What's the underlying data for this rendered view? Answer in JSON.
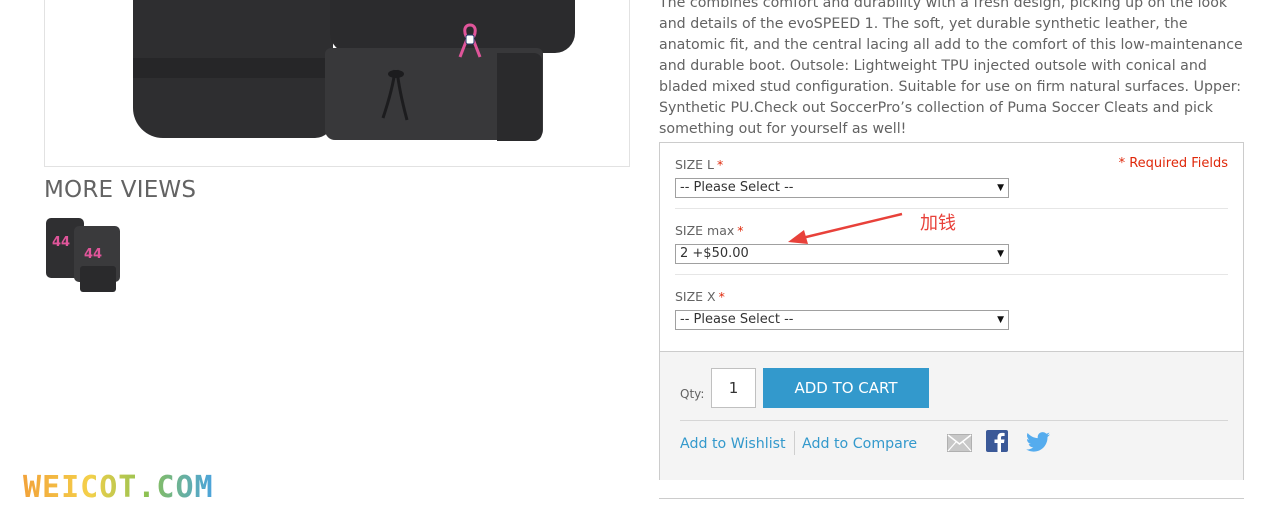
{
  "gallery": {
    "more_views_label": "MORE VIEWS"
  },
  "description": {
    "lines": [
      "The combines comfort and durability with a fresh design, picking up on the look",
      "and details of the evoSPEED 1. The soft, yet durable synthetic leather, the",
      "anatomic fit, and the central lacing all add to the comfort of this low-maintenance",
      "and durable boot. Outsole: Lightweight TPU injected outsole with conical and",
      "bladed mixed stud configuration. Suitable for use on firm natural surfaces. Upper:",
      "Synthetic PU.Check out SoccerPro’s collection of Puma Soccer Cleats and pick",
      "something out for yourself as well!"
    ]
  },
  "options": {
    "required_note": "* Required Fields",
    "required_marker": "*",
    "size_l": {
      "label": "SIZE L",
      "value": "-- Please Select --"
    },
    "size_max": {
      "label": "SIZE max",
      "value": "2 +$50.00"
    },
    "size_x": {
      "label": "SIZE X",
      "value": "-- Please Select --"
    }
  },
  "cart": {
    "qty_label": "Qty:",
    "qty_value": "1",
    "add_to_cart_label": "ADD TO CART",
    "wishlist_label": "Add to Wishlist",
    "compare_label": "Add to Compare"
  },
  "annotation": {
    "text": "加钱"
  },
  "watermark": {
    "text": "WEICOT.COM"
  },
  "icons": {
    "email": "email-icon",
    "facebook": "facebook-icon",
    "twitter": "twitter-icon",
    "dropdown": "chevron-down-icon"
  },
  "colors": {
    "accent": "#3399cc",
    "required": "#df280a",
    "annotation": "#e8413a",
    "facebook": "#3b5998",
    "twitter": "#55acee"
  }
}
